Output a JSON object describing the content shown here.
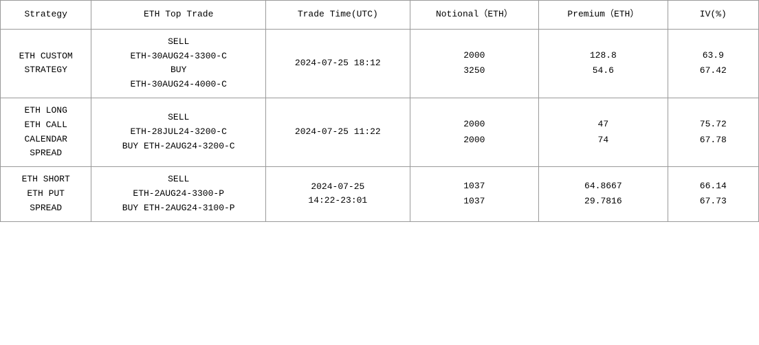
{
  "table": {
    "headers": [
      "Strategy",
      "ETH Top Trade",
      "Trade Time(UTC)",
      "Notional（ETH）",
      "Premium（ETH）",
      "IV(%)"
    ],
    "rows": [
      {
        "strategy": "ETH CUSTOM\nSTRATEGY",
        "toptrade": "SELL\nETH-30AUG24-3300-C\nBUY\nETH-30AUG24-4000-C",
        "tradetime": "2024-07-25 18:12",
        "notional": [
          "2000",
          "3250"
        ],
        "premium": [
          "128.8",
          "54.6"
        ],
        "iv": [
          "63.9",
          "67.42"
        ]
      },
      {
        "strategy": "ETH LONG\nETH CALL\nCALENDAR\nSPREAD",
        "toptrade": "SELL\nETH-28JUL24-3200-C\nBUY ETH-2AUG24-3200-C",
        "tradetime": "2024-07-25 11:22",
        "notional": [
          "2000",
          "2000"
        ],
        "premium": [
          "47",
          "74"
        ],
        "iv": [
          "75.72",
          "67.78"
        ]
      },
      {
        "strategy": "ETH SHORT\nETH PUT\nSPREAD",
        "toptrade": "SELL\nETH-2AUG24-3300-P\nBUY ETH-2AUG24-3100-P",
        "tradetime": "2024-07-25\n14:22-23:01",
        "notional": [
          "1037",
          "1037"
        ],
        "premium": [
          "64.8667",
          "29.7816"
        ],
        "iv": [
          "66.14",
          "67.73"
        ]
      }
    ]
  }
}
